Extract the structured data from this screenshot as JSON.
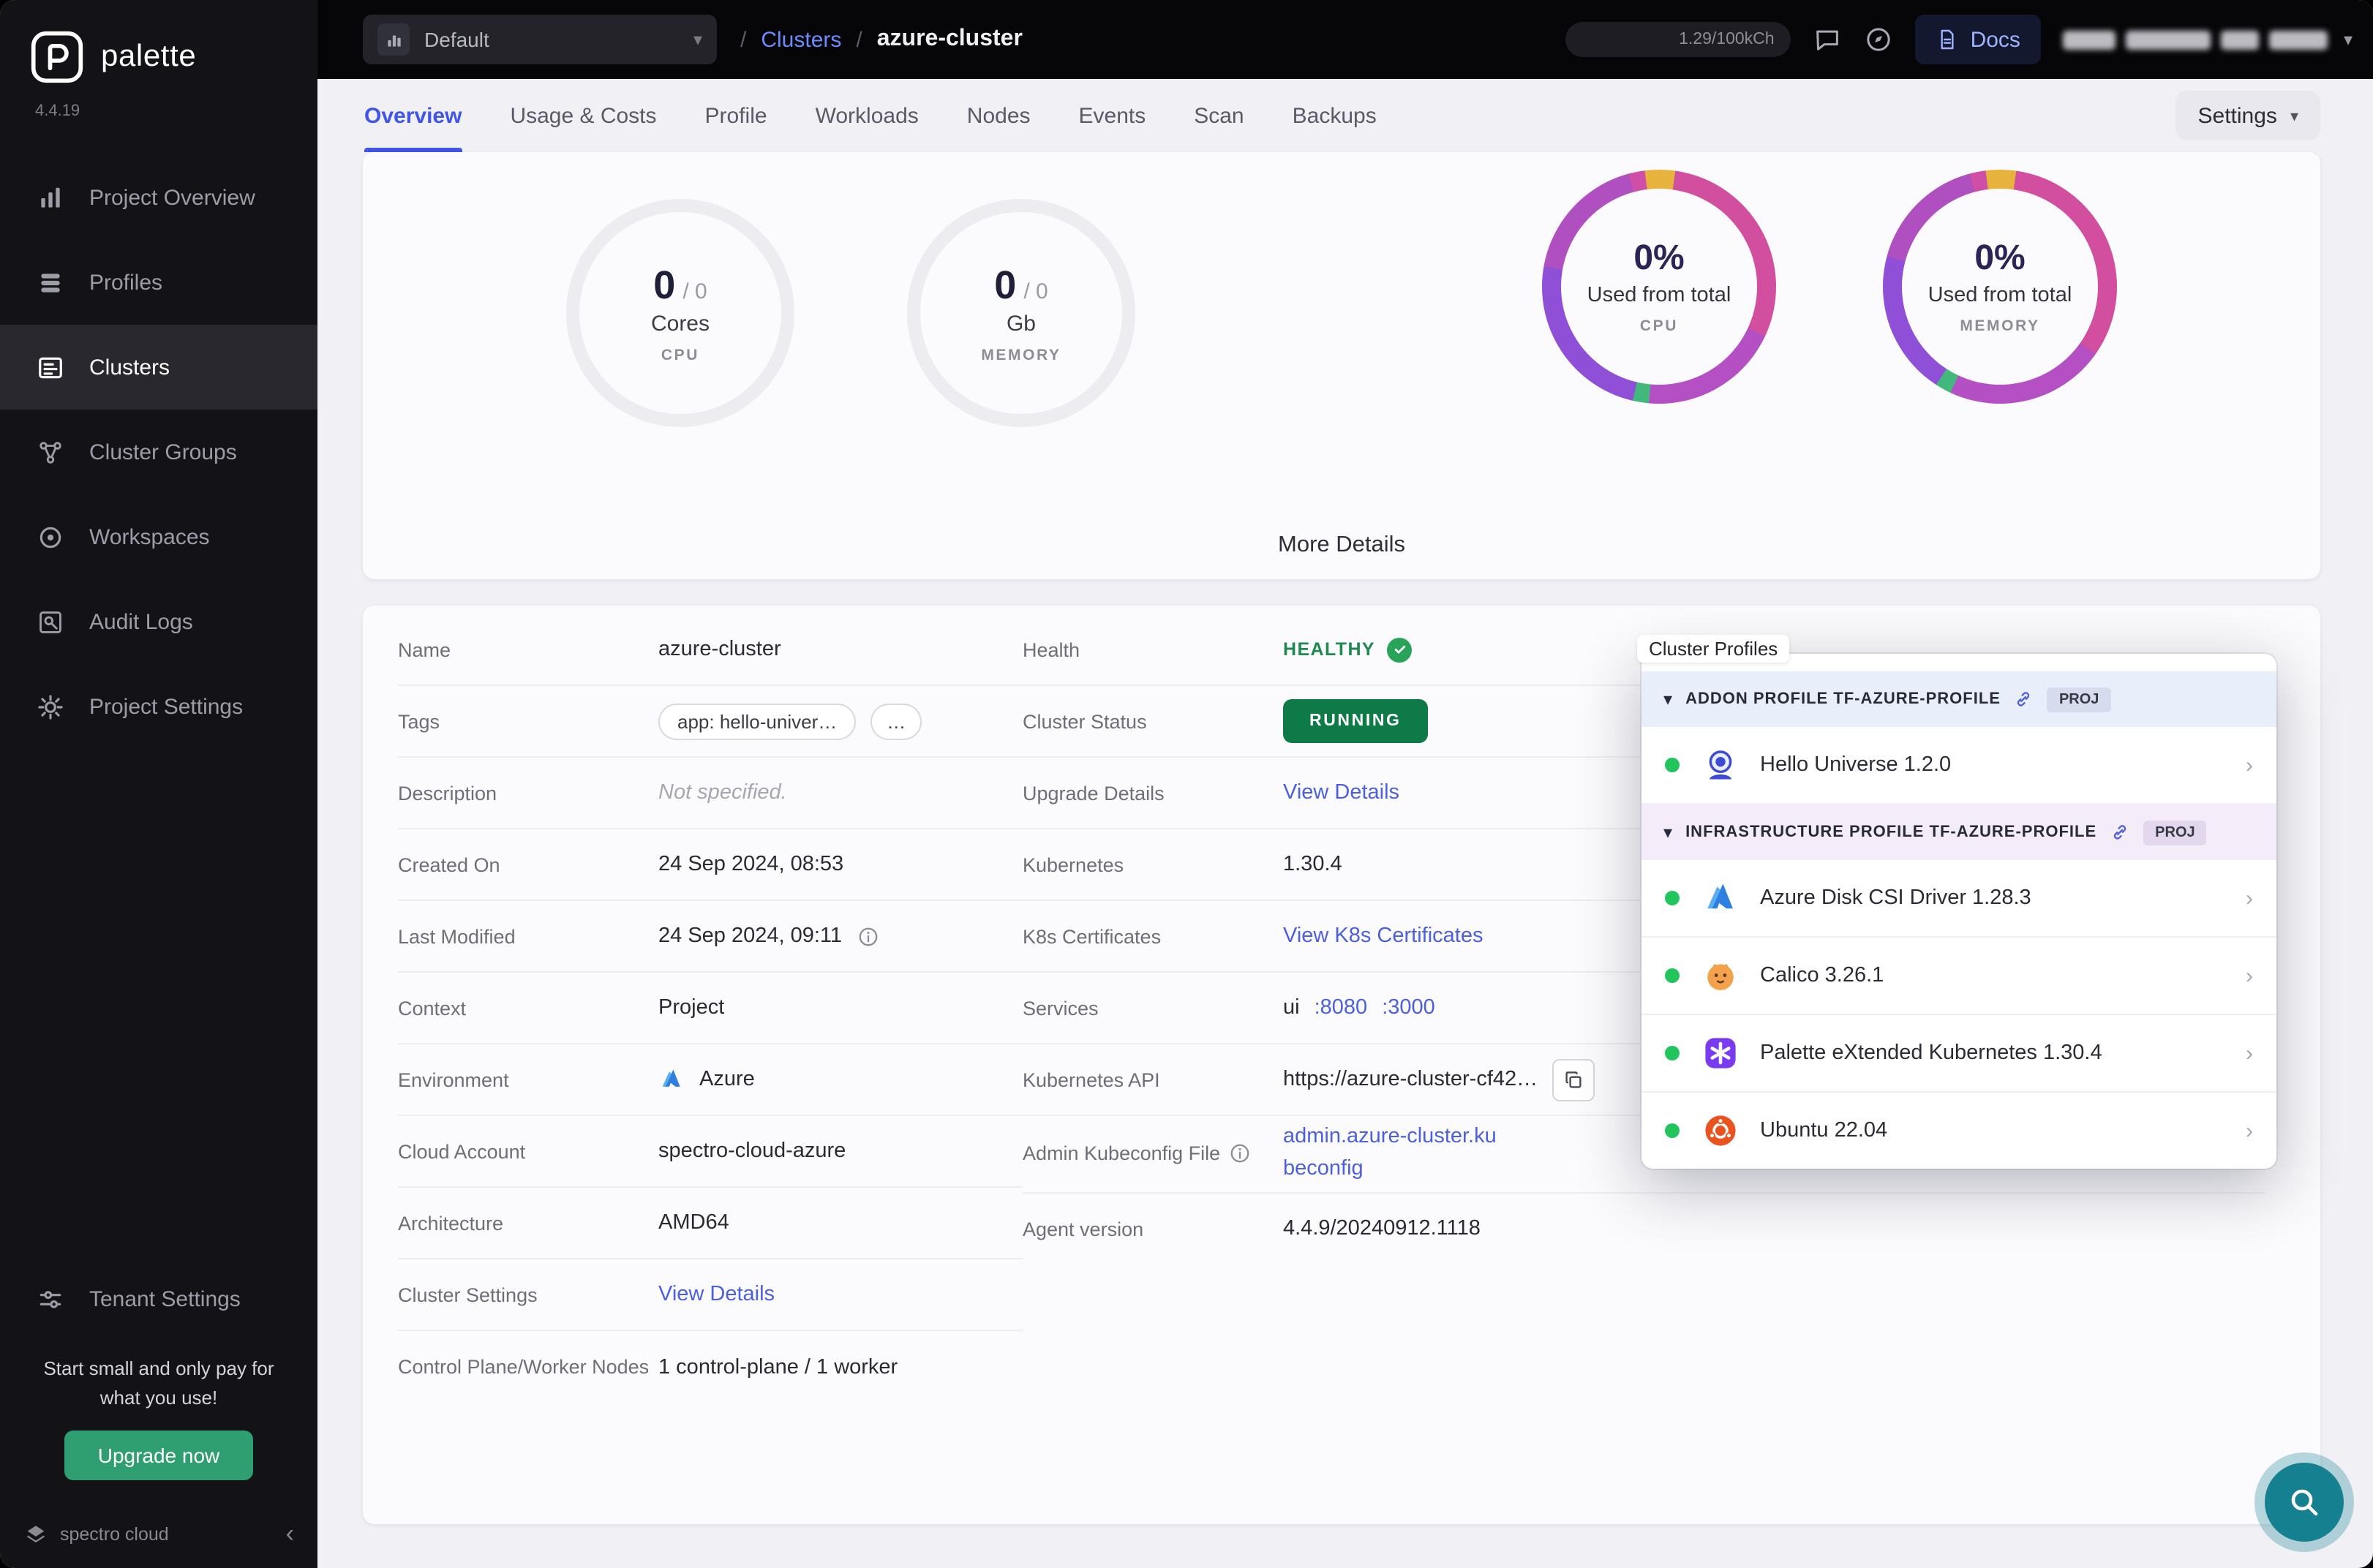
{
  "sidebar": {
    "logo_text": "palette",
    "version": "4.4.19",
    "items": [
      {
        "label": "Project Overview"
      },
      {
        "label": "Profiles"
      },
      {
        "label": "Clusters"
      },
      {
        "label": "Cluster Groups"
      },
      {
        "label": "Workspaces"
      },
      {
        "label": "Audit Logs"
      },
      {
        "label": "Project Settings"
      }
    ],
    "tenant_settings": "Tenant Settings",
    "promo_text": "Start small and only pay for what you use!",
    "upgrade_button": "Upgrade now",
    "brand_footer": "spectro cloud"
  },
  "topbar": {
    "project_selector": "Default",
    "separator": "/",
    "crumb_parent": "Clusters",
    "crumb_current": "azure-cluster",
    "usage": "1.29/100kCh",
    "docs": "Docs"
  },
  "tabs": {
    "items": [
      "Overview",
      "Usage & Costs",
      "Profile",
      "Workloads",
      "Nodes",
      "Events",
      "Scan",
      "Backups"
    ],
    "settings": "Settings"
  },
  "metrics": {
    "cpu_gauge": {
      "used": "0",
      "separator": "/ 0",
      "unit": "Cores",
      "label": "CPU"
    },
    "memory_gauge": {
      "used": "0",
      "separator": "/ 0",
      "unit": "Gb",
      "label": "MEMORY"
    },
    "cpu_donut": {
      "percent": "0%",
      "caption": "Used from total",
      "label": "CPU"
    },
    "memory_donut": {
      "percent": "0%",
      "caption": "Used from total",
      "label": "MEMORY"
    },
    "more_details": "More Details"
  },
  "details": {
    "left": [
      {
        "label": "Name",
        "value": "azure-cluster"
      },
      {
        "label": "Tags",
        "pill1": "app: hello-univer…",
        "pill2": "…"
      },
      {
        "label": "Description",
        "value": "Not specified."
      },
      {
        "label": "Created On",
        "value": "24 Sep 2024, 08:53"
      },
      {
        "label": "Last Modified",
        "value": "24 Sep 2024, 09:11"
      },
      {
        "label": "Context",
        "value": "Project"
      },
      {
        "label": "Environment",
        "value": "Azure"
      },
      {
        "label": "Cloud Account",
        "value": "spectro-cloud-azure"
      },
      {
        "label": "Architecture",
        "value": "AMD64"
      },
      {
        "label": "Cluster Settings",
        "value": "View Details"
      },
      {
        "label": "Control Plane/Worker Nodes",
        "value": "1 control-plane / 1 worker"
      }
    ],
    "right": [
      {
        "label": "Health",
        "value": "HEALTHY"
      },
      {
        "label": "Cluster Status",
        "value": "RUNNING"
      },
      {
        "label": "Upgrade Details",
        "value": "View Details"
      },
      {
        "label": "Kubernetes",
        "value": "1.30.4"
      },
      {
        "label": "K8s Certificates",
        "value": "View K8s Certificates"
      },
      {
        "label": "Services",
        "prefix": "ui",
        "links": [
          ":8080",
          ":3000"
        ]
      },
      {
        "label": "Kubernetes API",
        "value": "https://azure-cluster-cf42…"
      },
      {
        "label": "Admin Kubeconfig File",
        "value": "admin.azure-cluster.kubeconfig"
      },
      {
        "label": "Agent version",
        "value": "4.4.9/20240912.1118"
      }
    ]
  },
  "profiles_panel": {
    "title": "Cluster Profiles",
    "sections": [
      {
        "header": "ADDON PROFILE TF-AZURE-PROFILE",
        "badge": "PROJ",
        "items": [
          {
            "name": "Hello Universe 1.2.0"
          }
        ]
      },
      {
        "header": "INFRASTRUCTURE PROFILE TF-AZURE-PROFILE",
        "badge": "PROJ",
        "items": [
          {
            "name": "Azure Disk CSI Driver 1.28.3"
          },
          {
            "name": "Calico 3.26.1"
          },
          {
            "name": "Palette eXtended Kubernetes 1.30.4"
          },
          {
            "name": "Ubuntu 22.04"
          }
        ]
      }
    ]
  },
  "colors": {
    "accent_blue": "#3f54e8",
    "link_blue": "#4c5fdd",
    "healthy_green": "#1f8a4f",
    "running_green": "#0e7a48",
    "upgrade_green": "#2f9e70",
    "fab_teal": "#15808f"
  }
}
